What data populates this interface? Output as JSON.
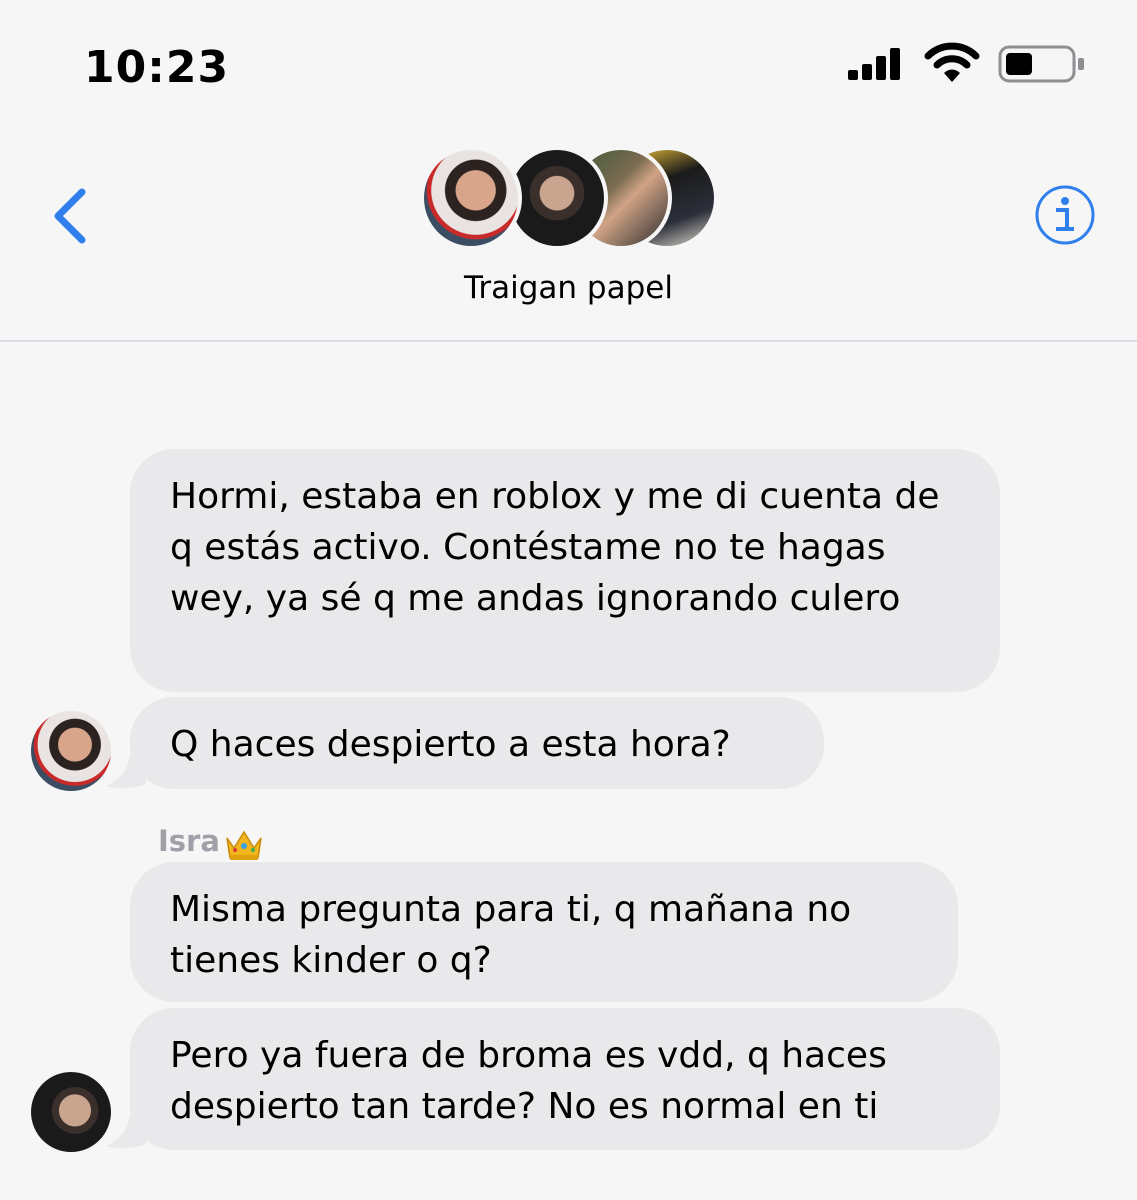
{
  "status_bar": {
    "time": "10:23"
  },
  "header": {
    "group_name": "Traigan papel"
  },
  "messages": [
    {
      "text": "Hormi, estaba en roblox y me di cuenta de q estás activo. Contéstame no te hagas wey, ya sé q me andas ignorando culero"
    },
    {
      "text": "Q haces despierto a esta hora?"
    },
    {
      "sender": "Isra",
      "text": "Misma pregunta para ti, q mañana no tienes kinder o q?"
    },
    {
      "text": "Pero ya fuera de broma es vdd, q haces despierto tan tarde? No es normal en ti"
    }
  ],
  "icons": {
    "back": "chevron-left-icon",
    "info": "info-icon",
    "crown": "crown-emoji"
  },
  "colors": {
    "accent": "#2f80ed",
    "bubble": "#e9e9eb",
    "background": "#f6f6f6",
    "sender_name": "#a0a0a8"
  }
}
